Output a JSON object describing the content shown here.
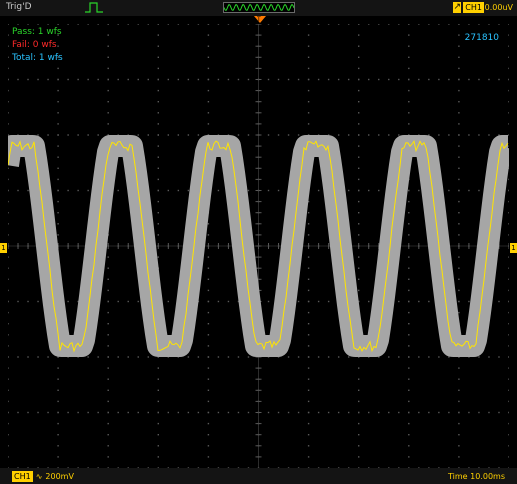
{
  "top_bar": {
    "trig_status": "Trig'D",
    "trigger_source": "CH1",
    "trigger_level": "0.00uV"
  },
  "markers": {
    "time_marker_label": "T",
    "left_level_marker": "1",
    "right_level_marker": "1"
  },
  "pass_fail": {
    "pass": "Pass: 1 wfs",
    "fail": "Fail: 0 wfs",
    "total": "Total: 1 wfs",
    "counter": "271810"
  },
  "bottom_bar": {
    "ch_label": "CH1",
    "ch_scale": "200mV",
    "timebase": "Time 10.00ms"
  },
  "colors": {
    "trace": "#ffe400",
    "mask": "#a6a6a6",
    "grid": "#5a5a5a",
    "pass": "#2ad52a",
    "fail": "#ff2a2a",
    "total": "#2ac3ff",
    "accent": "#ffd000"
  },
  "icons": [
    "pulse-icon",
    "memory-waveform-icon",
    "trigger-edge-icon",
    "trigger-position-marker-icon",
    "channel-level-marker-icon",
    "coupling-icon"
  ]
}
